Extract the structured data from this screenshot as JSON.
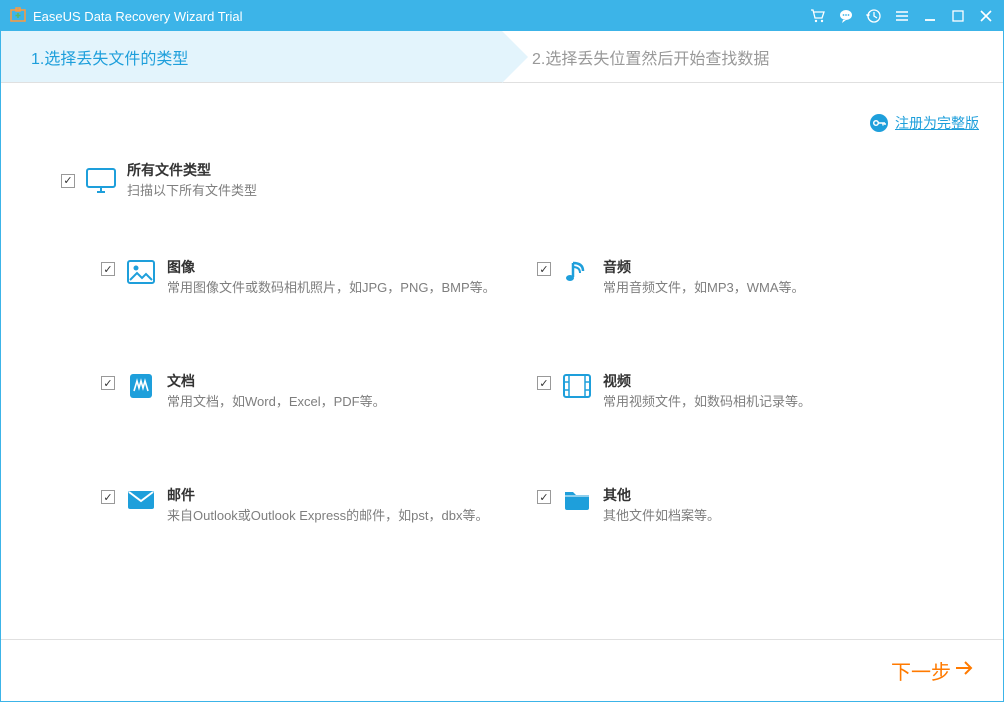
{
  "titlebar": {
    "title": "EaseUS Data Recovery Wizard Trial"
  },
  "steps": {
    "step1": "1.选择丢失文件的类型",
    "step2": "2.选择丢失位置然后开始查找数据"
  },
  "register": {
    "label": "注册为完整版"
  },
  "allTypes": {
    "title": "所有文件类型",
    "desc": "扫描以下所有文件类型"
  },
  "types": {
    "image": {
      "title": "图像",
      "desc": "常用图像文件或数码相机照片，如JPG，PNG，BMP等。"
    },
    "audio": {
      "title": "音频",
      "desc": "常用音频文件，如MP3，WMA等。"
    },
    "doc": {
      "title": "文档",
      "desc": "常用文档，如Word，Excel，PDF等。"
    },
    "video": {
      "title": "视频",
      "desc": "常用视频文件，如数码相机记录等。"
    },
    "email": {
      "title": "邮件",
      "desc": "来自Outlook或Outlook Express的邮件，如pst，dbx等。"
    },
    "other": {
      "title": "其他",
      "desc": "其他文件如档案等。"
    }
  },
  "footer": {
    "next": "下一步"
  }
}
